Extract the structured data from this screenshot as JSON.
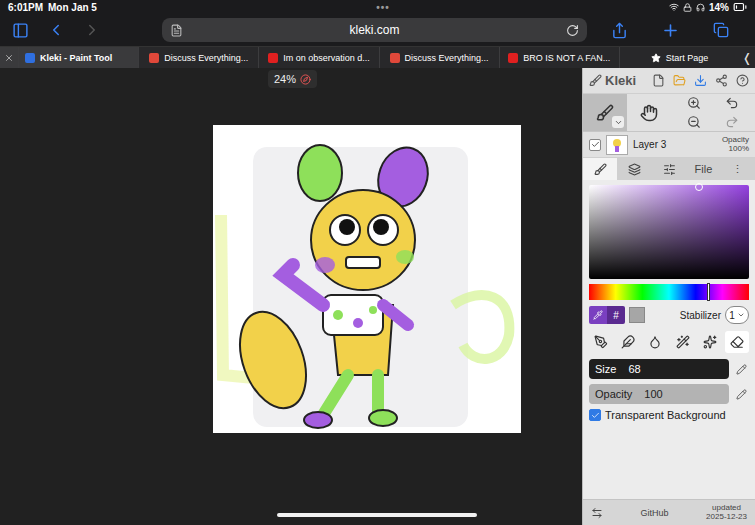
{
  "status_bar": {
    "time": "6:01PM",
    "date": "Mon Jan 5",
    "dots": "•••",
    "battery": "14%"
  },
  "browser": {
    "url": "kleki.com",
    "collapse": "❬",
    "tabs": [
      {
        "label": "Kleki - Paint Tool",
        "selected": true,
        "kind": "site",
        "color": "#2f6fe0"
      },
      {
        "label": "Discuss Everything...",
        "selected": false,
        "kind": "site",
        "color": "#e0483a"
      },
      {
        "label": "Im on observation d...",
        "selected": false,
        "kind": "site",
        "color": "#e02020"
      },
      {
        "label": "Discuss Everything...",
        "selected": false,
        "kind": "site",
        "color": "#e0483a"
      },
      {
        "label": "BRO IS NOT A FAN...",
        "selected": false,
        "kind": "site",
        "color": "#e02020"
      },
      {
        "label": "Start Page",
        "selected": false,
        "kind": "start",
        "color": "#ffffff"
      }
    ]
  },
  "canvas": {
    "zoom": "24%"
  },
  "app": {
    "name": "Kleki",
    "tools": [
      {
        "selected": true
      },
      {
        "selected": false
      }
    ],
    "layer": {
      "name": "Layer 3",
      "visible": true,
      "opacity_label": "Opacity",
      "opacity": "100%"
    },
    "panel_tabs": [
      {
        "kind": "icon",
        "selected": true
      },
      {
        "kind": "icon",
        "selected": false
      },
      {
        "kind": "icon",
        "selected": false
      },
      {
        "kind": "text",
        "label": "File",
        "selected": false
      },
      {
        "kind": "text",
        "label": "⋮",
        "selected": false
      }
    ],
    "color": {
      "hex_label": "#",
      "stabilizer_label": "Stabilizer",
      "stabilizer": "1"
    },
    "brushes": [
      {
        "selected": false
      },
      {
        "selected": false
      },
      {
        "selected": false
      },
      {
        "selected": false
      },
      {
        "selected": false
      },
      {
        "selected": true
      }
    ],
    "sliders": [
      {
        "label": "Size",
        "value": "68",
        "level": 1,
        "active": true
      },
      {
        "label": "Opacity",
        "value": "100",
        "level": 1,
        "active": false
      }
    ],
    "transparent_background": {
      "label": "Transparent Background",
      "checked": true
    },
    "footer": {
      "link": "GitHub",
      "updated_label": "updated",
      "updated_date": "2025-12-23"
    }
  }
}
